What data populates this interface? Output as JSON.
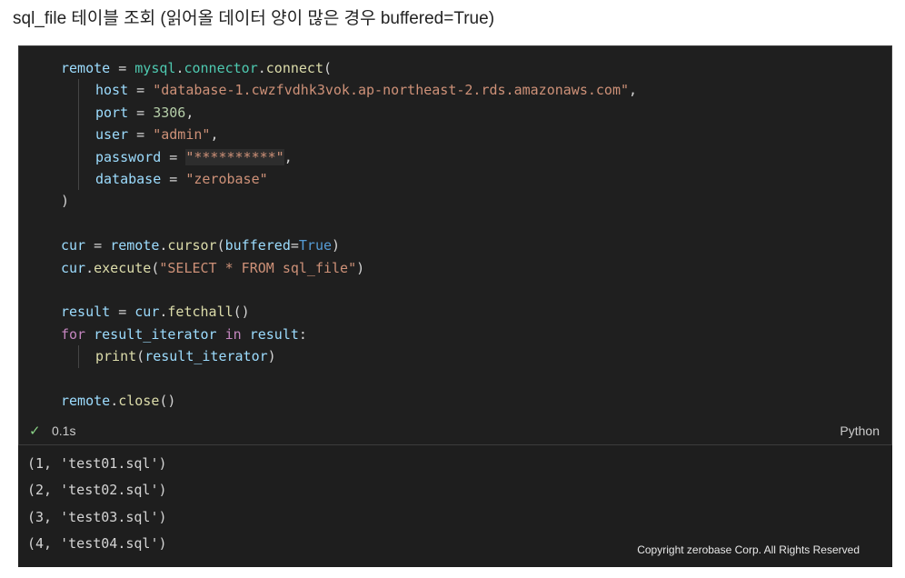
{
  "heading": "sql_file 테이블 조회 (읽어올 데이터 양이 많은 경우 buffered=True)",
  "code": {
    "l1": {
      "a": "remote",
      "b": " = ",
      "c": "mysql",
      "d": ".",
      "e": "connector",
      "f": ".",
      "g": "connect",
      "h": "("
    },
    "l2": {
      "a": "host",
      "b": " = ",
      "c": "\"database-1.cwzfvdhk3vok.ap-northeast-2.rds.amazonaws.com\"",
      "d": ","
    },
    "l3": {
      "a": "port",
      "b": " = ",
      "c": "3306",
      "d": ","
    },
    "l4": {
      "a": "user",
      "b": " = ",
      "c": "\"admin\"",
      "d": ","
    },
    "l5": {
      "a": "password",
      "b": " = ",
      "c": "\"**********\"",
      "d": ","
    },
    "l6": {
      "a": "database",
      "b": " = ",
      "c": "\"zerobase\""
    },
    "l7": {
      "a": ")"
    },
    "l9": {
      "a": "cur",
      "b": " = ",
      "c": "remote",
      "d": ".",
      "e": "cursor",
      "f": "(",
      "g": "buffered",
      "h": "=",
      "i": "True",
      "j": ")"
    },
    "l10": {
      "a": "cur",
      "b": ".",
      "c": "execute",
      "d": "(",
      "e": "\"SELECT * FROM sql_file\"",
      "f": ")"
    },
    "l12": {
      "a": "result",
      "b": " = ",
      "c": "cur",
      "d": ".",
      "e": "fetchall",
      "f": "()"
    },
    "l13": {
      "a": "for",
      "b": " ",
      "c": "result_iterator",
      "d": " ",
      "e": "in",
      "f": " ",
      "g": "result",
      "h": ":"
    },
    "l14": {
      "a": "print",
      "b": "(",
      "c": "result_iterator",
      "d": ")"
    },
    "l16": {
      "a": "remote",
      "b": ".",
      "c": "close",
      "d": "()"
    }
  },
  "status": {
    "check_icon": "check-icon",
    "time": "0.1s",
    "language": "Python"
  },
  "output": [
    "(1, 'test01.sql')",
    "(2, 'test02.sql')",
    "(3, 'test03.sql')",
    "(4, 'test04.sql')"
  ],
  "copyright": "Copyright zerobase Corp. All Rights Reserved"
}
